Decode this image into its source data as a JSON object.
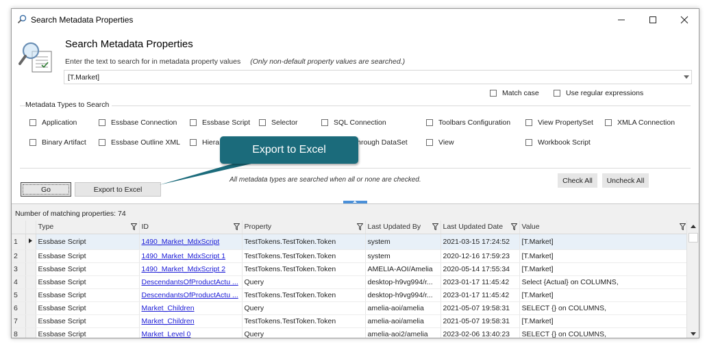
{
  "window": {
    "title": "Search Metadata Properties"
  },
  "header": {
    "title": "Search Metadata Properties",
    "instruction": "Enter the text to search for in metadata property values",
    "note": "(Only non-default property values are searched.)"
  },
  "search": {
    "value": "[T.Market]"
  },
  "options": {
    "match_case": "Match case",
    "regex": "Use regular expressions"
  },
  "types_group": {
    "label": "Metadata Types to Search",
    "row1": [
      "Application",
      "Essbase Connection",
      "Essbase Script",
      "Selector",
      "SQL Connection",
      "Toolbars Configuration",
      "View PropertySet",
      "XMLA Connection"
    ],
    "row2": [
      "Binary Artifact",
      "Essbase Outline XML",
      "Hiera",
      "sthrough DataSet",
      "View",
      "Workbook Script"
    ]
  },
  "actions": {
    "go": "Go",
    "export": "Export to Excel",
    "note": "All metadata types are searched when all or none are checked.",
    "check_all": "Check All",
    "uncheck_all": "Uncheck All"
  },
  "callout": {
    "text": "Export to Excel"
  },
  "results": {
    "count_text": "Number of matching properties: 74",
    "columns": [
      "Type",
      "ID",
      "Property",
      "Last Updated By",
      "Last Updated Date",
      "Value"
    ],
    "rows": [
      {
        "n": "1",
        "type": "Essbase Script",
        "id": "1490_Market_MdxScript",
        "property": "TestTokens.TestToken.Token",
        "by": "system",
        "date": "2021-03-15 17:24:52",
        "value": "[T.Market]"
      },
      {
        "n": "2",
        "type": "Essbase Script",
        "id": "1490_Market_MdxScript 1",
        "property": "TestTokens.TestToken.Token",
        "by": "system",
        "date": "2020-12-16 17:59:23",
        "value": "[T.Market]"
      },
      {
        "n": "3",
        "type": "Essbase Script",
        "id": "1490_Market_MdxScript 2",
        "property": "TestTokens.TestToken.Token",
        "by": "AMELIA-AOI/Amelia",
        "date": "2020-05-14 17:55:34",
        "value": "[T.Market]"
      },
      {
        "n": "4",
        "type": "Essbase Script",
        "id": "DescendantsOfProductActu ...",
        "property": "Query",
        "by": "desktop-h9vg994/r...",
        "date": "2023-01-17 11:45:42",
        "value": "Select {Actual} on COLUMNS,"
      },
      {
        "n": "5",
        "type": "Essbase Script",
        "id": "DescendantsOfProductActu ...",
        "property": "TestTokens.TestToken.Token",
        "by": "desktop-h9vg994/r...",
        "date": "2023-01-17 11:45:42",
        "value": "[T.Market]"
      },
      {
        "n": "6",
        "type": "Essbase Script",
        "id": "Market_Children",
        "property": "Query",
        "by": "amelia-aoi/amelia",
        "date": "2021-05-07 19:58:31",
        "value": "SELECT {} on COLUMNS,"
      },
      {
        "n": "7",
        "type": "Essbase Script",
        "id": "Market_Children",
        "property": "TestTokens.TestToken.Token",
        "by": "amelia-aoi/amelia",
        "date": "2021-05-07 19:58:31",
        "value": "[T.Market]"
      },
      {
        "n": "8",
        "type": "Essbase Script",
        "id": "Market_Level 0",
        "property": "Query",
        "by": "amelia-aoi2/amelia",
        "date": "2023-02-06 13:40:23",
        "value": "SELECT {} on COLUMNS,"
      }
    ]
  }
}
